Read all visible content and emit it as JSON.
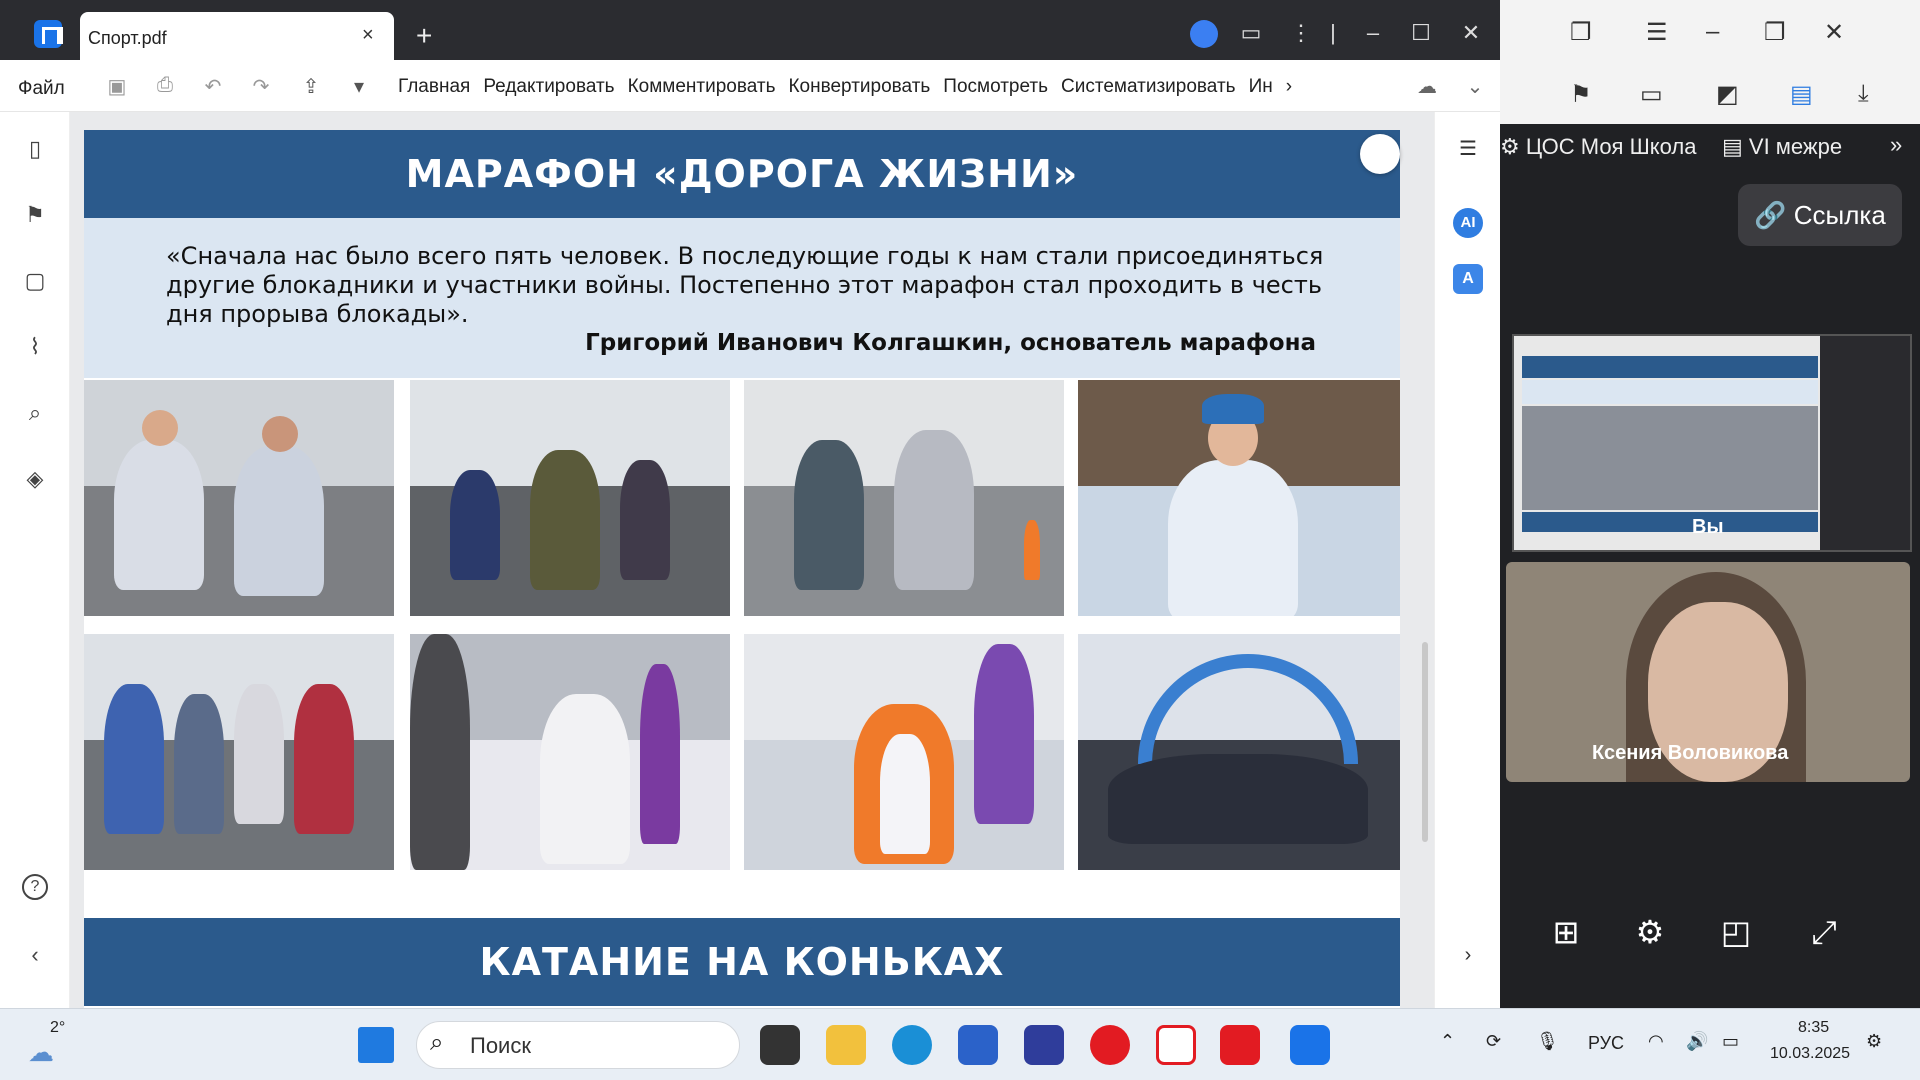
{
  "window": {
    "tab_title": "Спорт.pdf",
    "tab_close": "×",
    "new_tab": "+"
  },
  "toolbar": {
    "file_menu": "Файл",
    "menu": [
      "Главная",
      "Редактировать",
      "Комментировать",
      "Конвертировать",
      "Посмотреть",
      "Систематизировать",
      "Ин"
    ],
    "more": "›"
  },
  "page": {
    "banner1": "МАРАФОН «ДОРОГА ЖИЗНИ»",
    "quote": "«Сначала нас было всего пять человек. В последующие годы к нам стали присоединяться другие блокадники и участники войны. Постепенно этот марафон стал проходить в честь дня прорыва блокады».",
    "author": "Григорий Иванович Колгашкин, основатель марафона",
    "banner2": "КАТАНИЕ НА КОНЬКАХ"
  },
  "right_tools": {
    "ai_label": "AI",
    "translate_label": "A"
  },
  "side": {
    "bookmarks": [
      "ЦОС Моя Школа",
      "VI межре"
    ],
    "bookmarks_more": "»",
    "link_button": "Ссылка",
    "self_label": "Вы",
    "participant": "Ксения Воловикова"
  },
  "taskbar": {
    "weather": "2°",
    "search_placeholder": "Поиск",
    "language": "РУС",
    "time": "8:35",
    "date": "10.03.2025"
  },
  "colors": {
    "banner": "#2b5a8c",
    "quote_bg": "#dbe6f2",
    "accent": "#1a73e8"
  }
}
